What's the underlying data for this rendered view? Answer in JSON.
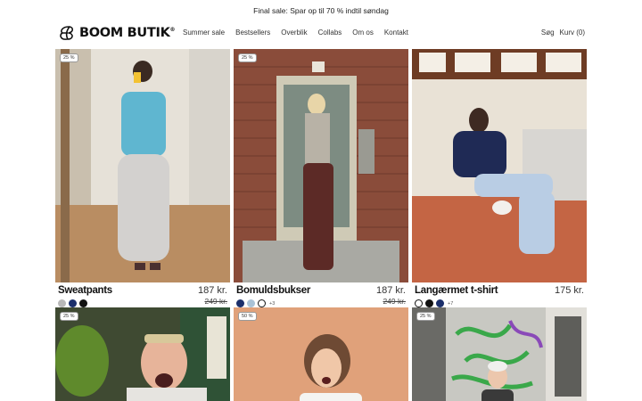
{
  "announcement": "Final sale: Spar op til 70 % indtil søndag",
  "brand": {
    "name": "BOOM BUTIK",
    "reg": "®"
  },
  "nav": [
    "Summer sale",
    "Bestsellers",
    "Overblik",
    "Collabs",
    "Om os",
    "Kontakt"
  ],
  "utility": {
    "search": "Søg",
    "cart": "Kurv (0)"
  },
  "products": [
    {
      "badge": "25 %",
      "title": "Sweatpants",
      "price": "187 kr.",
      "old_price": "249 kr.",
      "swatches": [
        "#b8b8b8",
        "#1b2f6b",
        "#111111"
      ],
      "more": ""
    },
    {
      "badge": "25 %",
      "title": "Bomuldsbukser",
      "price": "187 kr.",
      "old_price": "249 kr.",
      "swatches": [
        "#1b2f6b",
        "#a9c2d6",
        "#ffffff"
      ],
      "more": "+3"
    },
    {
      "badge": "",
      "title": "Langærmet t-shirt",
      "price": "175 kr.",
      "old_price": "",
      "swatches": [
        "#ffffff",
        "#111111",
        "#1b2f6b"
      ],
      "more": "+7"
    },
    {
      "badge": "25 %",
      "title": "",
      "price": "",
      "old_price": "",
      "swatches": [],
      "more": ""
    },
    {
      "badge": "50 %",
      "title": "",
      "price": "",
      "old_price": "",
      "swatches": [],
      "more": ""
    },
    {
      "badge": "25 %",
      "title": "",
      "price": "",
      "old_price": "",
      "swatches": [],
      "more": ""
    }
  ]
}
